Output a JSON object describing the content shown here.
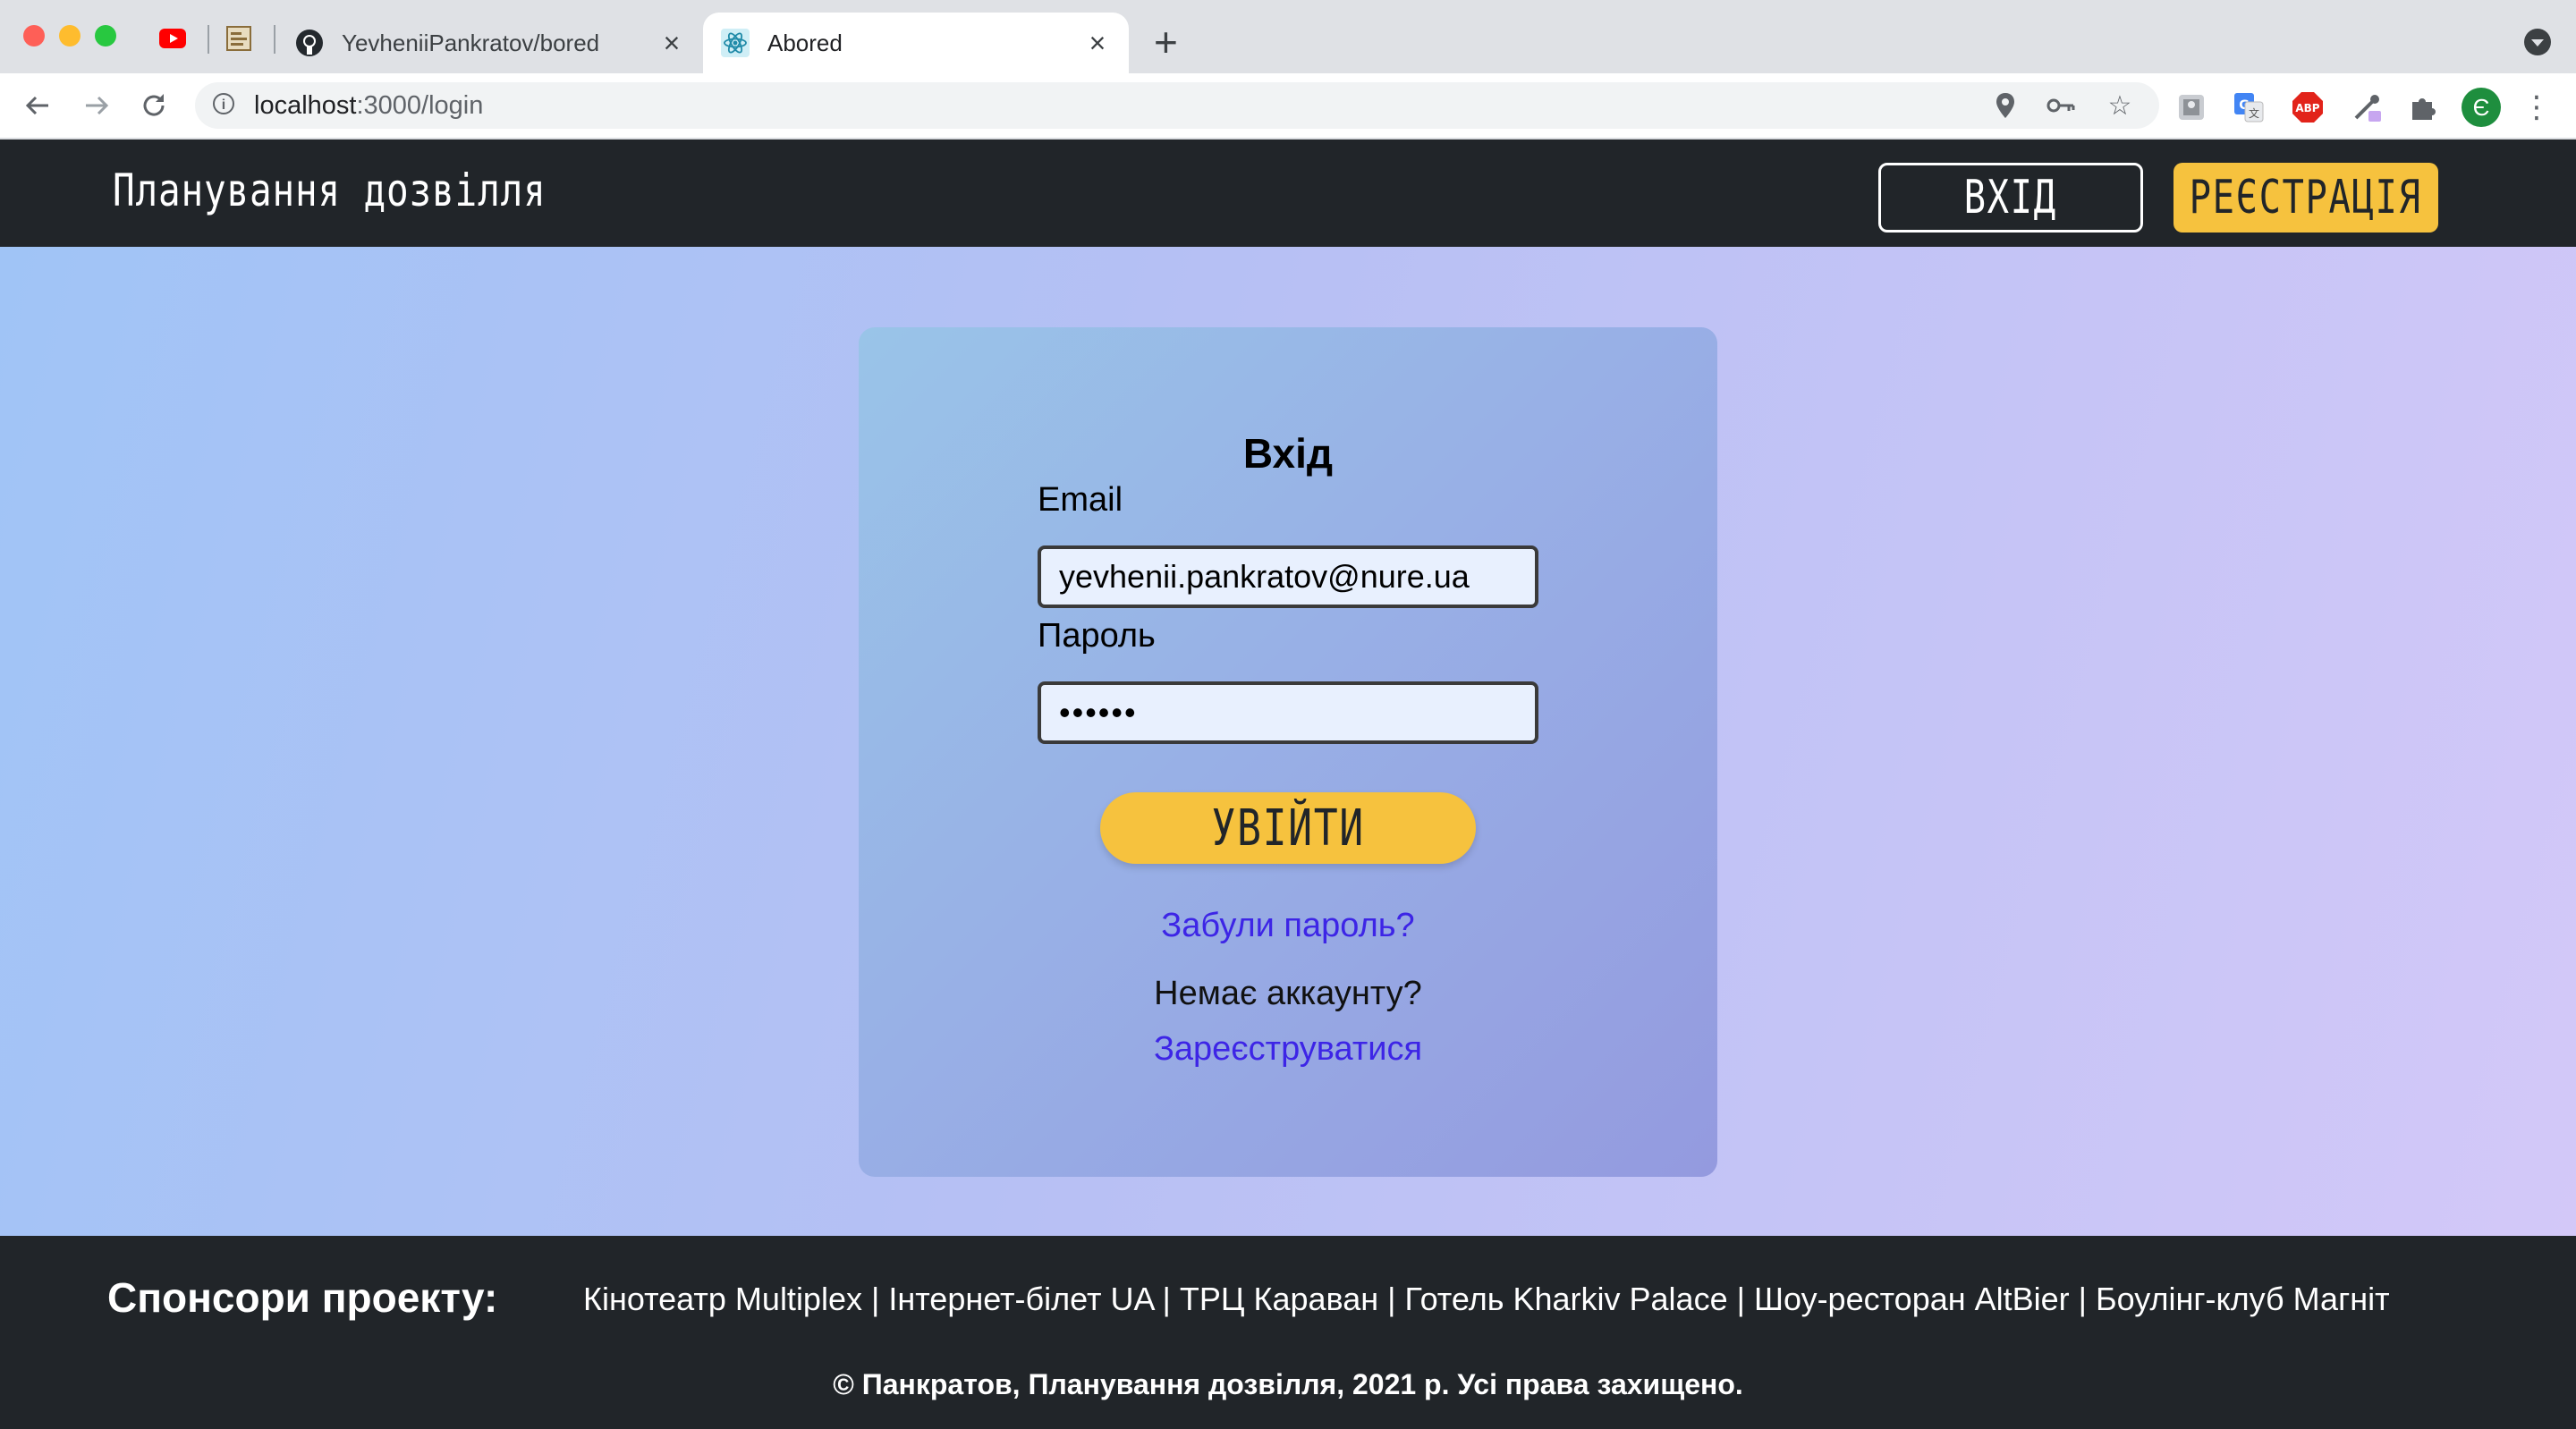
{
  "browser": {
    "tabs": [
      {
        "label": "YevheniiPankratov/bored",
        "favicon": "github-icon",
        "active": false
      },
      {
        "label": "Abored",
        "favicon": "react-icon",
        "active": true
      }
    ],
    "pinned_tabs": [
      "youtube-icon",
      "page-icon"
    ],
    "url": {
      "host": "localhost",
      "path": ":3000/login"
    },
    "profile_initial": "Є",
    "adblock_label": "ABP"
  },
  "header": {
    "brand": "Планування дозвілля",
    "login_label": "ВХІД",
    "register_label": "РЕЄСТРАЦІЯ",
    "accent_color": "#f6c23e"
  },
  "login_form": {
    "title": "Вхід",
    "email_label": "Email",
    "email_value": "yevhenii.pankratov@nure.ua",
    "password_label": "Пароль",
    "password_value": "••••••",
    "submit_label": "УВІЙТИ",
    "forgot_link": "Забули пароль?",
    "no_account_text": "Немає аккаунту?",
    "register_link": "Зареєструватися",
    "link_color": "#3d25e6"
  },
  "footer": {
    "sponsors_title": "Спонсори проекту:",
    "sponsors": "Кінотеатр Multiplex | Інтернет-білет UA | ТРЦ Караван | Готель Kharkiv Palace | Шоу-ресторан AltBier | Боулінг-клуб Магніт",
    "copyright": "© Панкратов, Планування дозвілля, 2021 р. Усі права захищено."
  }
}
